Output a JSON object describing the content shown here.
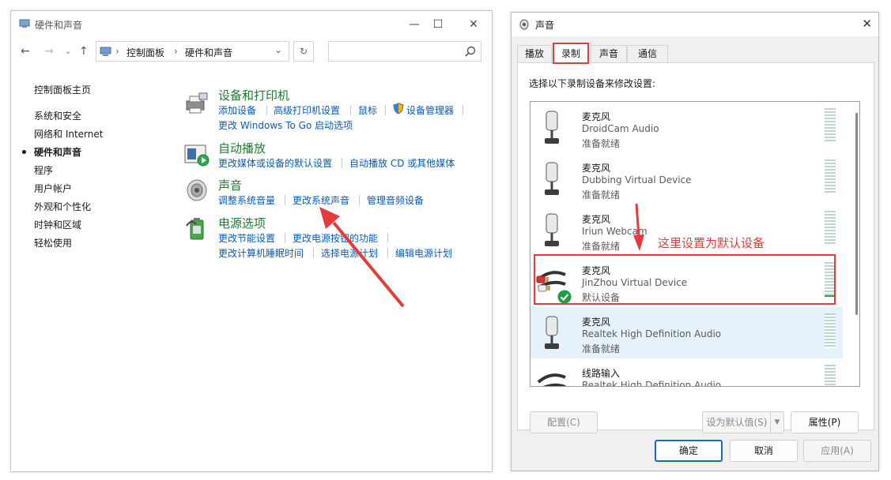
{
  "control_panel": {
    "title": "硬件和声音",
    "window_buttons": {
      "minimize": "—",
      "maximize": "☐",
      "close": "✕"
    },
    "nav": {
      "back": "←",
      "forward": "→",
      "up": "↑",
      "refresh": "↻"
    },
    "breadcrumb": [
      "控制面板",
      "硬件和声音"
    ],
    "breadcrumb_sep": "›",
    "search": {
      "placeholder": ""
    },
    "sidebar": {
      "items": [
        {
          "label": "控制面板主页"
        },
        {
          "label": "系统和安全"
        },
        {
          "label": "网络和 Internet"
        },
        {
          "label": "硬件和声音",
          "active": true
        },
        {
          "label": "程序"
        },
        {
          "label": "用户帐户"
        },
        {
          "label": "外观和个性化"
        },
        {
          "label": "时钟和区域"
        },
        {
          "label": "轻松使用"
        }
      ]
    },
    "categories": [
      {
        "title": "设备和打印机",
        "icon": "printer-icon",
        "links": [
          "添加设备",
          "高级打印机设置",
          "鼠标",
          "设备管理器",
          "更改 Windows To Go 启动选项"
        ]
      },
      {
        "title": "自动播放",
        "icon": "autoplay-icon",
        "links": [
          "更改媒体或设备的默认设置",
          "自动播放 CD 或其他媒体"
        ]
      },
      {
        "title": "声音",
        "icon": "speaker-icon",
        "links": [
          "调整系统音量",
          "更改系统声音",
          "管理音频设备"
        ]
      },
      {
        "title": "电源选项",
        "icon": "battery-icon",
        "links": [
          "更改节能设置",
          "更改电源按钮的功能",
          "更改计算机睡眠时间",
          "选择电源计划",
          "编辑电源计划"
        ]
      }
    ]
  },
  "sound_dialog": {
    "title": "声音",
    "close": "✕",
    "tabs": [
      "播放",
      "录制",
      "声音",
      "通信"
    ],
    "selected_tab": "录制",
    "instruction": "选择以下录制设备来修改设置:",
    "devices": [
      {
        "name": "麦克风",
        "description": "DroidCam Audio",
        "status": "准备就绪",
        "level": 0
      },
      {
        "name": "麦克风",
        "description": "Dubbing Virtual Device",
        "status": "准备就绪",
        "level": 0
      },
      {
        "name": "麦克风",
        "description": "Iriun Webcam",
        "status": "准备就绪",
        "level": 0
      },
      {
        "name": "麦克风",
        "description": "JinZhou Virtual Device",
        "status": "默认设备",
        "default": true,
        "level": 0.05
      },
      {
        "name": "麦克风",
        "description": "Realtek High Definition Audio",
        "status": "准备就绪",
        "selected": true,
        "level": 0
      },
      {
        "name": "线路输入",
        "description": "Realtek High Definition Audio",
        "status": "",
        "level": 0
      }
    ],
    "buttons": {
      "configure": "配置(C)",
      "set_default": "设为默认值(S)",
      "properties": "属性(P)",
      "ok": "确定",
      "cancel": "取消",
      "apply": "应用(A)"
    }
  },
  "annotation": {
    "text": "这里设置为默认设备",
    "color": "#e53b3b"
  },
  "colors": {
    "link": "#0a5ab4",
    "category_title": "#1e7a34",
    "accent": "#1967c8"
  }
}
